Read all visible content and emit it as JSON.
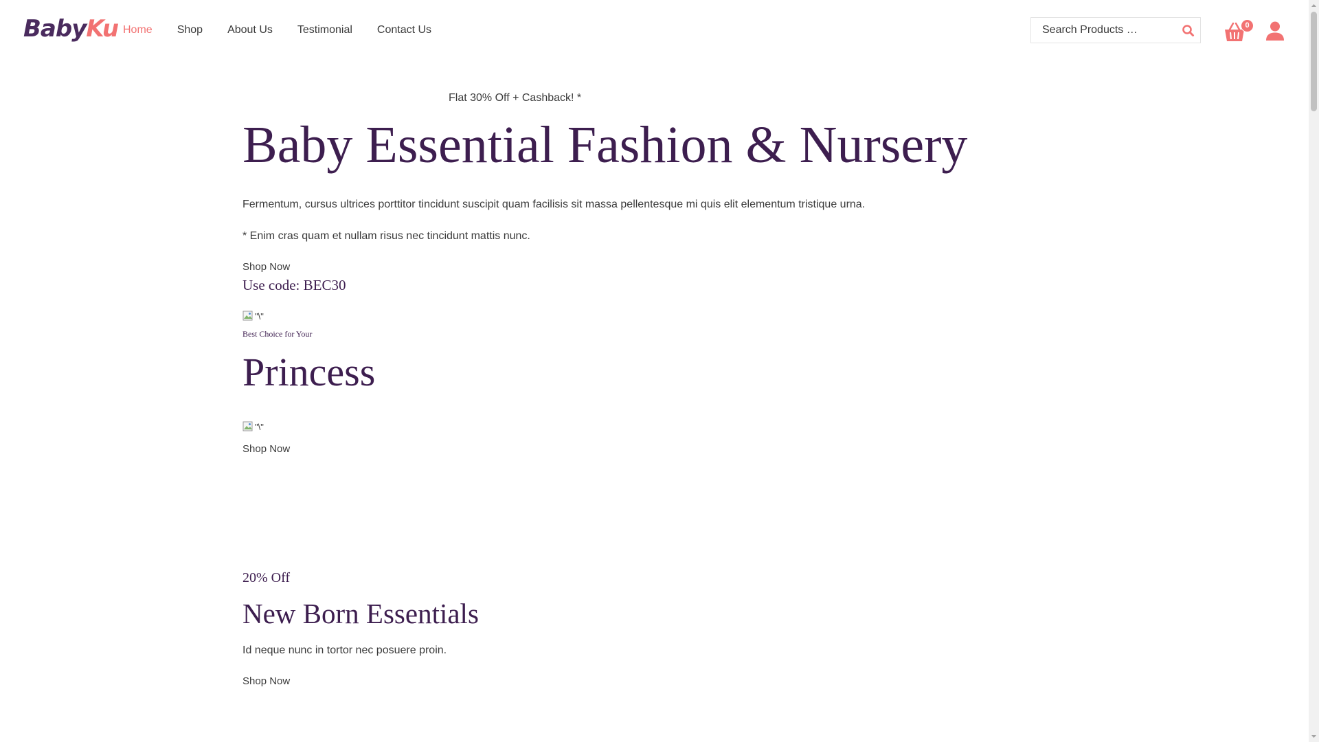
{
  "header": {
    "logo": {
      "part1": "Baby",
      "part2": "Ku"
    },
    "nav": [
      {
        "label": "Home",
        "active": true
      },
      {
        "label": "Shop"
      },
      {
        "label": "About Us"
      },
      {
        "label": "Testimonial"
      },
      {
        "label": "Contact Us"
      }
    ],
    "search": {
      "placeholder": "Search Products …",
      "icon": "search-icon"
    },
    "cart": {
      "count": "0",
      "icon": "basket-icon"
    },
    "account": {
      "icon": "user-icon"
    }
  },
  "colors": {
    "accent": "#f27272",
    "heading": "#3d1e4f",
    "text": "#3a3a3a"
  },
  "hero": {
    "promo": "Flat 30% Off + Cashback! *",
    "title": "Baby Essential Fashion & Nursery",
    "description": "Fermentum, cursus ultrices porttitor tincidunt suscipit quam facilisis sit massa pellentesque mi quis elit elementum tristique urna.",
    "note": "* Enim cras quam et nullam risus nec tincidunt mattis nunc.",
    "cta": "Shop Now",
    "code": "Use code: BEC30"
  },
  "feature": {
    "image_alt": "\"\\\"",
    "eyebrow": "Best Choice for Your",
    "title": "Princess",
    "image2_alt": "\"\\\"",
    "cta": "Shop Now"
  },
  "newborn": {
    "discount": "20% Off",
    "title": "New Born Essentials",
    "description": "Id neque nunc in tortor nec posuere proin.",
    "cta": "Shop Now"
  }
}
